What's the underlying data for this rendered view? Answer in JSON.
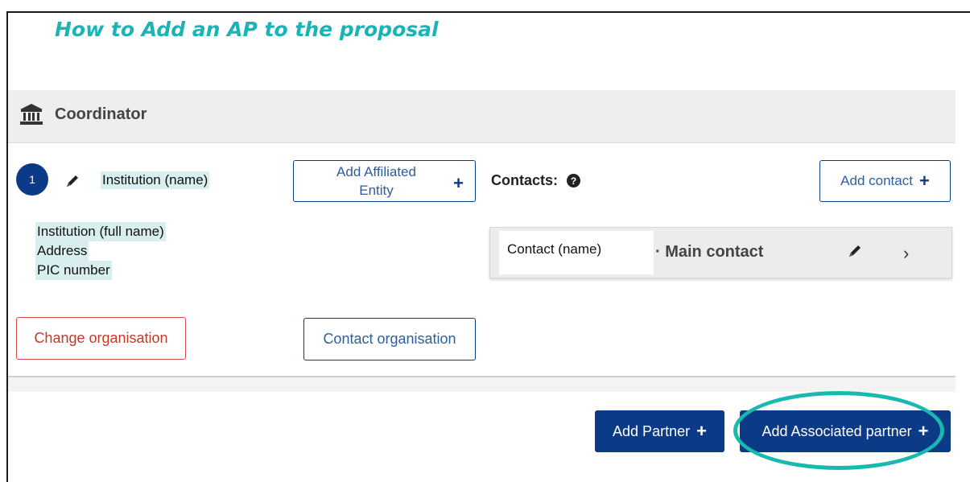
{
  "title": "How to Add an AP to the proposal",
  "coordinator": {
    "icon": "institution-icon",
    "label": "Coordinator"
  },
  "participant": {
    "number": "1",
    "name": "Institution (name)",
    "full_name": "Institution (full name)",
    "address": "Address",
    "pic": "PIC number"
  },
  "buttons": {
    "add_affiliated_line1": "Add Affiliated",
    "add_affiliated_line2": "Entity",
    "add_affiliated_plus": "+",
    "add_contact": "Add contact",
    "add_contact_plus": "+",
    "change_org": "Change organisation",
    "contact_org": "Contact organisation",
    "add_partner": "Add Partner",
    "add_partner_plus": "+",
    "add_associated": "Add Associated partner",
    "add_associated_plus": "+"
  },
  "contacts": {
    "label": "Contacts:",
    "help": "?",
    "contact_name": "Contact (name)",
    "role": "· Main contact",
    "chevron": "›"
  },
  "colors": {
    "primary": "#0b3a86",
    "title_teal": "#1bb3b5",
    "highlight_ellipse": "#1ab9b0",
    "danger": "#d84a4a"
  }
}
